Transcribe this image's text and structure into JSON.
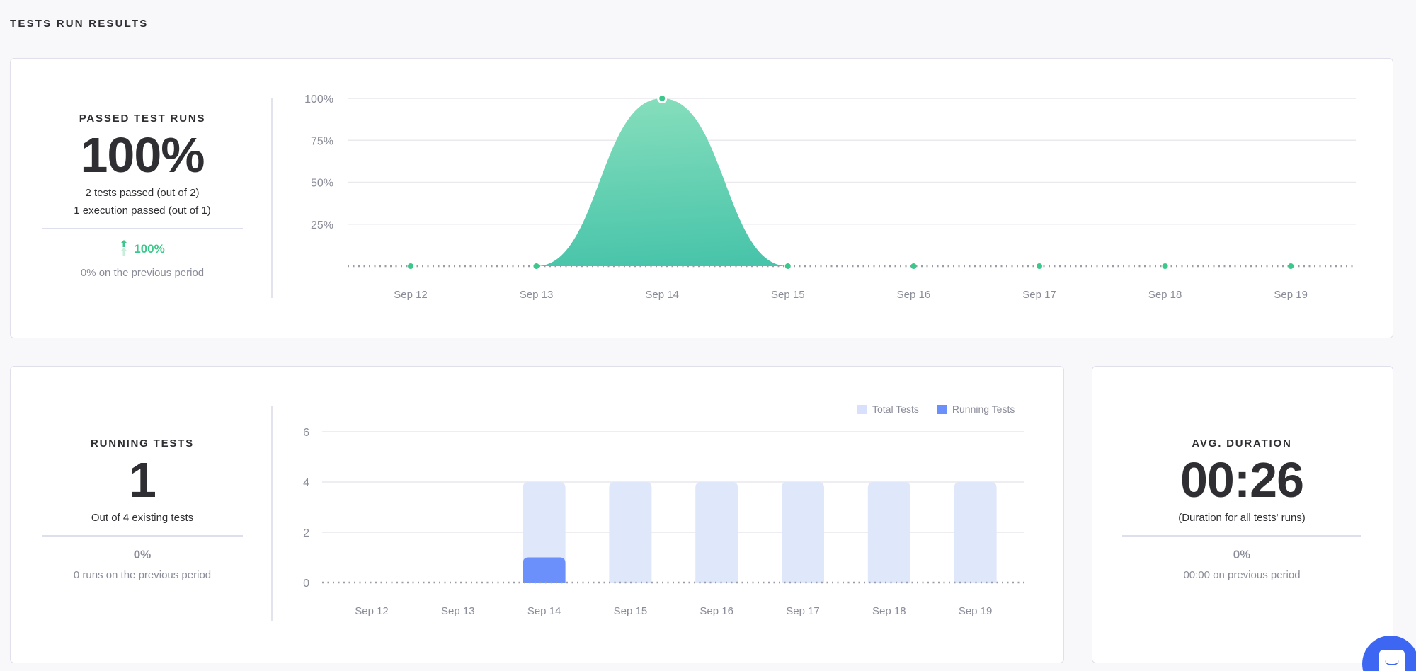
{
  "page": {
    "title": "TESTS RUN RESULTS"
  },
  "passed_card": {
    "label": "PASSED TEST RUNS",
    "value": "100%",
    "sub_line_1": "2 tests passed (out of 2)",
    "sub_line_2": "1 execution passed (out of 1)",
    "change_icon": "arrow-up-icon",
    "change": "100%",
    "previous": "0% on the previous period",
    "accent_color": "#3cc88a"
  },
  "running_card": {
    "label": "RUNNING TESTS",
    "value": "1",
    "sub_line_1": "Out of 4 existing tests",
    "change": "0%",
    "previous": "0 runs on the previous period"
  },
  "duration_card": {
    "label": "AVG. DURATION",
    "value": "00:26",
    "sub_line_1": "(Duration for all tests' runs)",
    "change": "0%",
    "previous": "00:00 on previous period"
  },
  "chat_widget": {
    "icon": "chat-icon",
    "color": "#3d67f2"
  },
  "chart_data": [
    {
      "id": "passed-chart",
      "type": "area",
      "title": "",
      "xlabel": "",
      "ylabel": "",
      "categories": [
        "Sep 12",
        "Sep 13",
        "Sep 14",
        "Sep 15",
        "Sep 16",
        "Sep 17",
        "Sep 18",
        "Sep 19"
      ],
      "series": [
        {
          "name": "Passed Test Runs",
          "values": [
            0,
            0,
            100,
            0,
            0,
            0,
            0,
            0
          ],
          "color": "#3cc88a"
        }
      ],
      "yticks": [
        "25%",
        "50%",
        "75%",
        "100%"
      ],
      "ytick_values": [
        25,
        50,
        75,
        100
      ],
      "ylim": [
        0,
        100
      ],
      "grid": true,
      "legend": "none"
    },
    {
      "id": "running-chart",
      "type": "bar",
      "title": "",
      "xlabel": "",
      "ylabel": "",
      "categories": [
        "Sep 12",
        "Sep 13",
        "Sep 14",
        "Sep 15",
        "Sep 16",
        "Sep 17",
        "Sep 18",
        "Sep 19"
      ],
      "series": [
        {
          "name": "Total Tests",
          "values": [
            0,
            0,
            4,
            4,
            4,
            4,
            4,
            4
          ],
          "color": "#dfe7fb"
        },
        {
          "name": "Running Tests",
          "values": [
            0,
            0,
            1,
            0,
            0,
            0,
            0,
            0
          ],
          "color": "#6b8ffb"
        }
      ],
      "yticks": [
        "0",
        "2",
        "4",
        "6"
      ],
      "ytick_values": [
        0,
        2,
        4,
        6
      ],
      "ylim": [
        0,
        6
      ],
      "grid": true,
      "legend": "top-right"
    }
  ]
}
